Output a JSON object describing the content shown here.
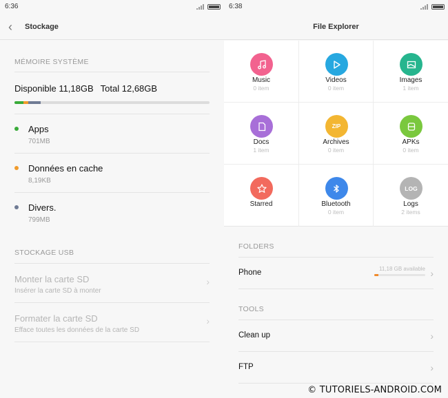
{
  "left": {
    "status_time": "6:36",
    "title": "Stockage",
    "system_header": "MÉMOIRE SYSTÈME",
    "available": "Disponible 11,18GB",
    "total": "Total 12,68GB",
    "usage_bar": [
      {
        "name": "Apps",
        "fraction": 0.047,
        "color": "#3aab3a"
      },
      {
        "name": "Données en cache",
        "fraction": 0.023,
        "color": "#f09b2c"
      },
      {
        "name": "Divers.",
        "fraction": 0.063,
        "color": "#6f7b94"
      }
    ],
    "categories": [
      {
        "name": "Apps",
        "size": "701MB",
        "color": "#3aab3a"
      },
      {
        "name": "Données en cache",
        "size": "8,19KB",
        "color": "#f09b2c"
      },
      {
        "name": "Divers.",
        "size": "799MB",
        "color": "#6f7b94"
      }
    ],
    "usb_header": "STOCKAGE USB",
    "usb_items": [
      {
        "title": "Monter la carte SD",
        "subtitle": "Insérer la carte SD à monter"
      },
      {
        "title": "Formater la carte SD",
        "subtitle": "Efface toutes les données de la carte SD"
      }
    ]
  },
  "right": {
    "status_time": "6:38",
    "title": "File Explorer",
    "grid": [
      {
        "label": "Music",
        "count": "0 item",
        "color": "#f2628f",
        "icon": "music-note-icon"
      },
      {
        "label": "Videos",
        "count": "0 item",
        "color": "#27a8e0",
        "icon": "play-icon"
      },
      {
        "label": "Images",
        "count": "1 item",
        "color": "#26b58e",
        "icon": "image-icon"
      },
      {
        "label": "Docs",
        "count": "1 item",
        "color": "#a86fd8",
        "icon": "document-icon"
      },
      {
        "label": "Archives",
        "count": "0 item",
        "color": "#f3b632",
        "icon": "zip-icon",
        "glyph": "ZIP"
      },
      {
        "label": "APKs",
        "count": "0 item",
        "color": "#7ac83e",
        "icon": "apk-icon"
      },
      {
        "label": "Starred",
        "count": "",
        "color": "#f26a5d",
        "icon": "star-icon"
      },
      {
        "label": "Bluetooth",
        "count": "0 item",
        "color": "#3e88ea",
        "icon": "bluetooth-icon"
      },
      {
        "label": "Logs",
        "count": "2 items",
        "color": "#b4b4b4",
        "icon": "log-icon",
        "glyph": "LOG"
      }
    ],
    "folders_header": "FOLDERS",
    "phone_label": "Phone",
    "phone_available": "11,18 GB available",
    "phone_used_fraction": 0.08,
    "phone_bar_color": "#f08b2c",
    "tools_header": "TOOLS",
    "tools": [
      "Clean up",
      "FTP"
    ]
  },
  "watermark": "© TUTORIELS-ANDROID.COM"
}
